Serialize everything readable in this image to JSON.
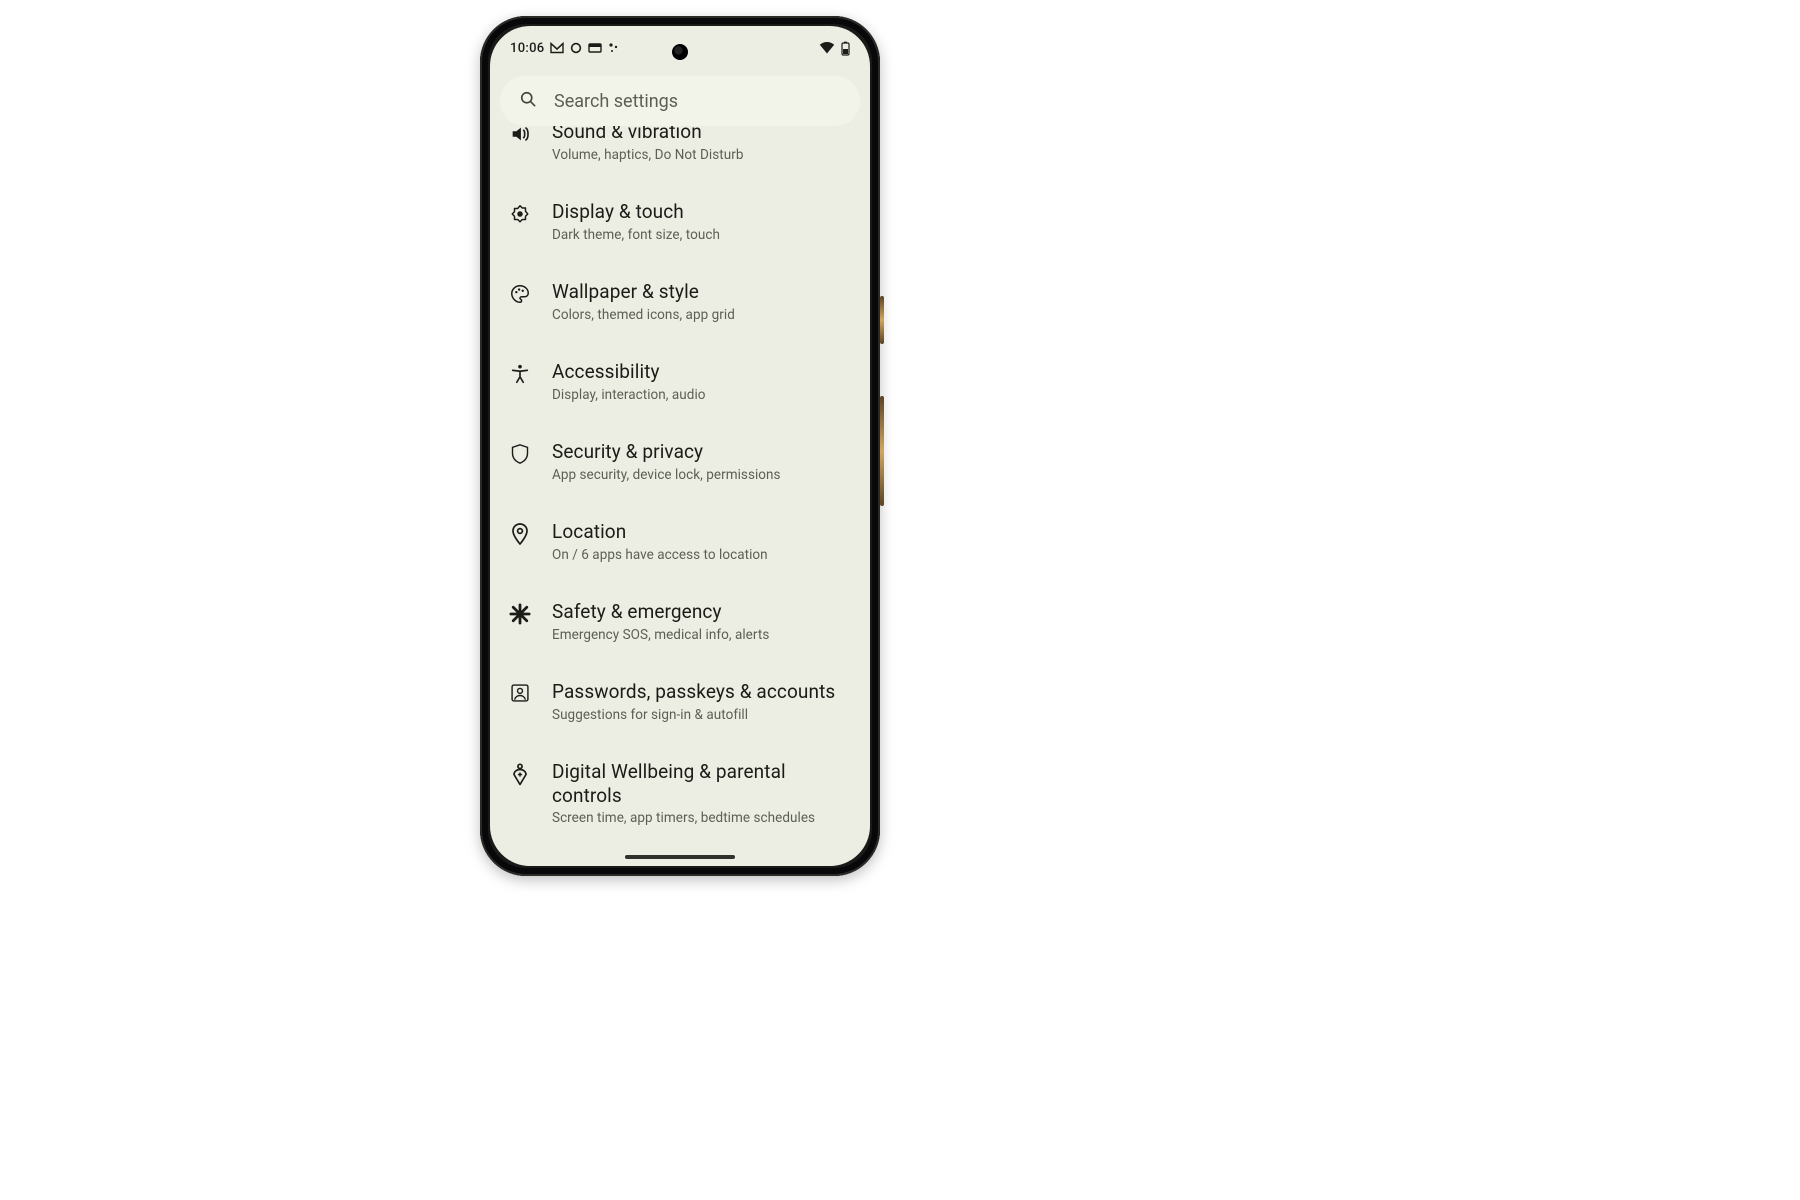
{
  "status": {
    "time": "10:06"
  },
  "search": {
    "placeholder": "Search settings"
  },
  "items": [
    {
      "icon": "volume",
      "title": "Sound & vibration",
      "sub": "Volume, haptics, Do Not Disturb"
    },
    {
      "icon": "brightness",
      "title": "Display & touch",
      "sub": "Dark theme, font size, touch"
    },
    {
      "icon": "palette",
      "title": "Wallpaper & style",
      "sub": "Colors, themed icons, app grid"
    },
    {
      "icon": "accessibility",
      "title": "Accessibility",
      "sub": "Display, interaction, audio"
    },
    {
      "icon": "shield",
      "title": "Security & privacy",
      "sub": "App security, device lock, permissions"
    },
    {
      "icon": "location",
      "title": "Location",
      "sub": "On / 6 apps have access to location"
    },
    {
      "icon": "emergency",
      "title": "Safety & emergency",
      "sub": "Emergency SOS, medical info, alerts"
    },
    {
      "icon": "account",
      "title": "Passwords, passkeys & accounts",
      "sub": "Suggestions for sign-in & autofill"
    },
    {
      "icon": "wellbeing",
      "title": "Digital Wellbeing & parental controls",
      "sub": "Screen time, app timers, bedtime schedules"
    }
  ]
}
